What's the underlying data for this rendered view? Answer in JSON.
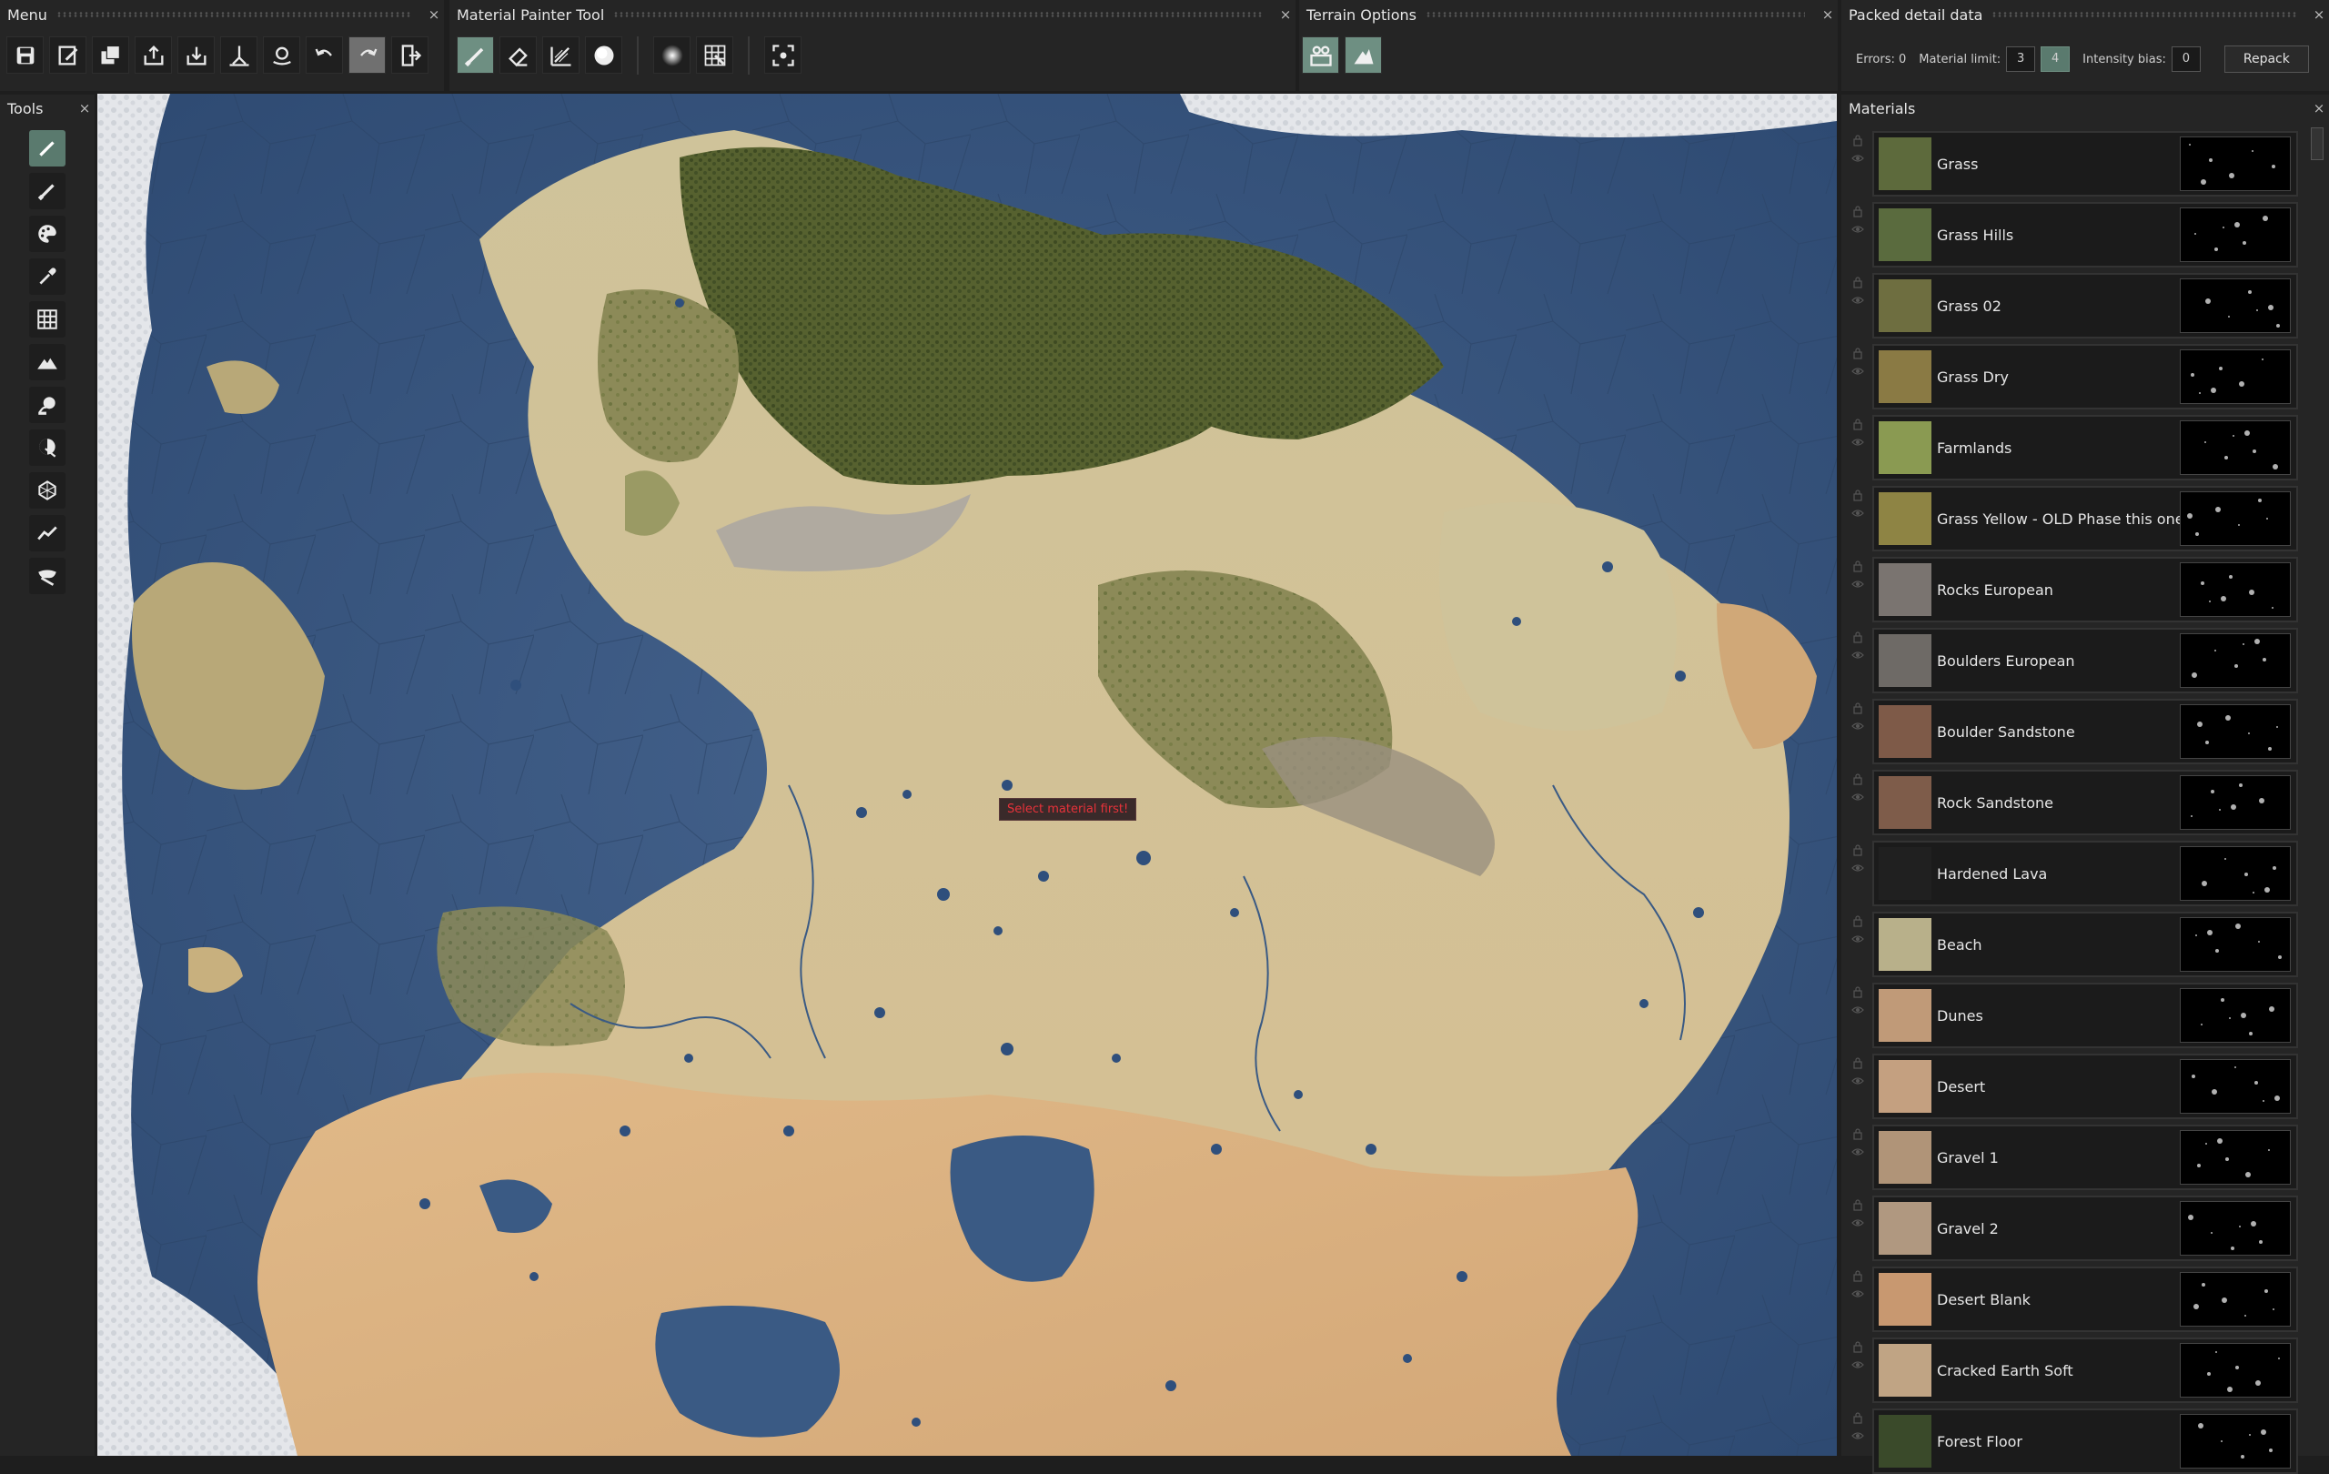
{
  "panels": {
    "menu": {
      "title": "Menu",
      "close": "×"
    },
    "painter": {
      "title": "Material Painter Tool",
      "close": "×"
    },
    "terrain": {
      "title": "Terrain Options",
      "close": "×"
    },
    "packed": {
      "title": "Packed detail data",
      "close": "×"
    },
    "tools": {
      "title": "Tools",
      "close": "×"
    },
    "materials": {
      "title": "Materials",
      "close": "×"
    }
  },
  "menu_buttons": [
    "save-icon",
    "save-as-icon",
    "save-all-icon",
    "export-icon",
    "import-icon",
    "merge-icon",
    "settings-icon",
    "undo-icon",
    "redo-icon",
    "exit-icon"
  ],
  "painter_buttons": [
    "brush-icon",
    "eraser-icon",
    "gradient-icon",
    "sphere-icon",
    "soft-brush-icon",
    "grid-icon",
    "focus-icon"
  ],
  "terrain_buttons": [
    "terrain-view-icon",
    "terrain-mountain-icon"
  ],
  "tools": [
    "paint-brush-icon",
    "brush-icon",
    "palette-icon",
    "eyedropper-icon",
    "grid-icon",
    "mountain-icon",
    "fill-icon",
    "blend-icon",
    "shape-icon",
    "line-icon",
    "mask-icon"
  ],
  "packed": {
    "errors_label": "Errors: 0",
    "limit_label": "Material limit:",
    "limit_options": [
      "3",
      "4"
    ],
    "limit_selected": "4",
    "bias_label": "Intensity bias:",
    "bias_value": "0",
    "repack": "Repack"
  },
  "tooltip": "Select material first!",
  "materials": [
    {
      "name": "Grass",
      "color": "#5d6a3c"
    },
    {
      "name": "Grass Hills",
      "color": "#5a6b3e"
    },
    {
      "name": "Grass 02",
      "color": "#6e6e40"
    },
    {
      "name": "Grass Dry",
      "color": "#8a7a44"
    },
    {
      "name": "Farmlands",
      "color": "#8a9a52"
    },
    {
      "name": "Grass Yellow - OLD Phase this one ...",
      "color": "#8e8444"
    },
    {
      "name": "Rocks European",
      "color": "#7a7470"
    },
    {
      "name": "Boulders European",
      "color": "#6e6a66"
    },
    {
      "name": "Boulder Sandstone",
      "color": "#7e5a48"
    },
    {
      "name": "Rock Sandstone",
      "color": "#7e5c4a"
    },
    {
      "name": "Hardened Lava",
      "color": "#202020"
    },
    {
      "name": "Beach",
      "color": "#b8b08a"
    },
    {
      "name": "Dunes",
      "color": "#c09a78"
    },
    {
      "name": "Desert",
      "color": "#c4a080"
    },
    {
      "name": "Gravel 1",
      "color": "#b09478"
    },
    {
      "name": "Gravel 2",
      "color": "#b09880"
    },
    {
      "name": "Desert Blank",
      "color": "#c89870"
    },
    {
      "name": "Cracked Earth Soft",
      "color": "#c0a484"
    },
    {
      "name": "Forest Floor",
      "color": "#3a4a2a"
    }
  ]
}
